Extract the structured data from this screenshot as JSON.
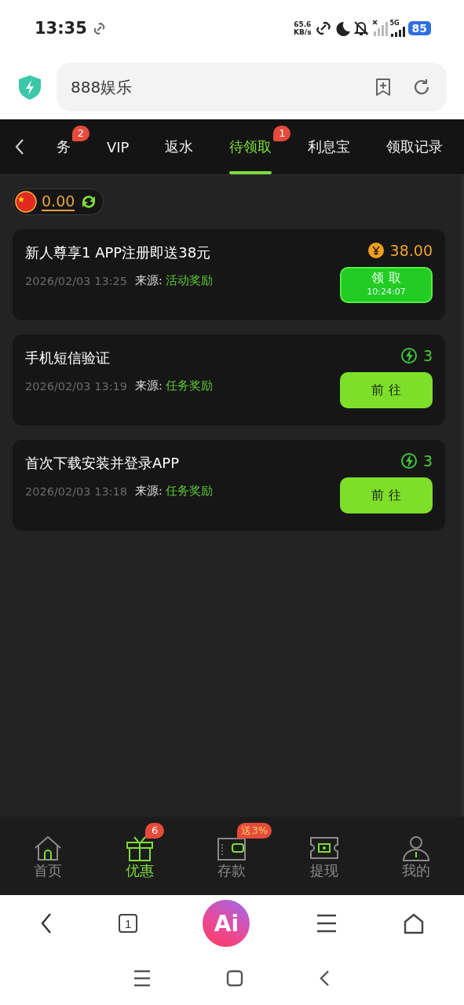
{
  "status_bar": {
    "time": "13:35",
    "net_speed": "65.6",
    "net_unit": "KB/s",
    "network": "5G",
    "battery": "85"
  },
  "address_bar": {
    "value": "888娱乐"
  },
  "tabs": [
    {
      "label": "务",
      "selected": false,
      "badge": "2"
    },
    {
      "label": "VIP",
      "selected": false
    },
    {
      "label": "返水",
      "selected": false
    },
    {
      "label": "待领取",
      "selected": true,
      "badge": "1"
    },
    {
      "label": "利息宝",
      "selected": false
    },
    {
      "label": "领取记录",
      "selected": false
    }
  ],
  "balance": {
    "amount": "0.00"
  },
  "rewards": [
    {
      "title": "新人尊享1 APP注册即送38元",
      "time": "2026/02/03 13:25",
      "source_label": "来源:",
      "source": "活动奖励",
      "kind": "money",
      "reward": "38.00",
      "button": {
        "kind": "claim",
        "label": "领 取",
        "countdown": "10:24:07"
      }
    },
    {
      "title": "手机短信验证",
      "time": "2026/02/03 13:19",
      "source_label": "来源:",
      "source": "任务奖励",
      "kind": "energy",
      "reward": "3",
      "button": {
        "kind": "go",
        "label": "前 往"
      }
    },
    {
      "title": "首次下载安装并登录APP",
      "time": "2026/02/03 13:18",
      "source_label": "来源:",
      "source": "任务奖励",
      "kind": "energy",
      "reward": "3",
      "button": {
        "kind": "go",
        "label": "前 往"
      }
    }
  ],
  "bottom_nav": [
    {
      "kind": "home",
      "label": "首页",
      "selected": false
    },
    {
      "kind": "gift",
      "label": "优惠",
      "selected": true,
      "badge": "6"
    },
    {
      "kind": "wallet",
      "label": "存款",
      "selected": false,
      "badge": "送3%"
    },
    {
      "kind": "cash",
      "label": "提现",
      "selected": false
    },
    {
      "kind": "user",
      "label": "我的",
      "selected": false
    }
  ],
  "browser_toolbar": {
    "tab_count": "1",
    "ai_label": "Ai"
  }
}
